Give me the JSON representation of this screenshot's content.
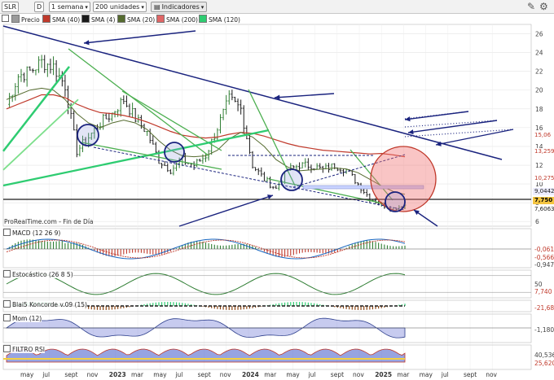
{
  "toolbar": {
    "symbol": "SLR",
    "d_label": "D",
    "period": "1 semana",
    "units": "200 unidades",
    "indicators": "Indicadores"
  },
  "legend": [
    {
      "label": "Precio",
      "color": "#9a9a9a",
      "name": "legend-precio"
    },
    {
      "label": "SMA (40)",
      "color": "#c0392b",
      "name": "legend-sma-40"
    },
    {
      "label": "SMA (4)",
      "color": "#1a1a1a",
      "name": "legend-sma-4"
    },
    {
      "label": "SMA (20)",
      "color": "#556b2f",
      "name": "legend-sma-20"
    },
    {
      "label": "SMA (200)",
      "color": "#e06666",
      "name": "legend-sma-200"
    },
    {
      "label": "SMA (120)",
      "color": "#2ecc71",
      "name": "legend-sma-120"
    }
  ],
  "source": "ProRealTime.com - Fin de Día",
  "price_tags": [
    {
      "value": "15,06",
      "color": "#c0392b",
      "bg": "#ffffff"
    },
    {
      "value": "13,259",
      "color": "#c0392b",
      "bg": "#ffffff"
    },
    {
      "value": "10,275",
      "color": "#c0392b",
      "bg": "#ffffff"
    },
    {
      "value": "9,0442",
      "color": "#1a1a1a",
      "bg": "#eeeeff"
    },
    {
      "value": "7,750",
      "color": "#000000",
      "bg": "#f4c542"
    },
    {
      "value": "7,6063",
      "color": "#1a1a1a",
      "bg": "#ffffff"
    }
  ],
  "panels": {
    "macd": {
      "title": "MACD (12 26 9)",
      "values": [
        "-0,061",
        "-0,566",
        "-0,947"
      ]
    },
    "stoch": {
      "title": "Estocástico (26 8 5)",
      "values": [
        "50",
        "7,740"
      ]
    },
    "koncorde": {
      "title": "Blai5 Koncorde v.09 (15)",
      "values": [
        "-21,68"
      ]
    },
    "mom": {
      "title": "Mom (12)",
      "values": [
        "-1,180"
      ]
    },
    "filtro": {
      "title": "FILTRO RSI",
      "values": [
        "40,536",
        "25,620"
      ]
    }
  },
  "colors": {
    "bull": "#2e7d32",
    "bear": "#1a1a1a",
    "trend": "#1a237e",
    "sma40": "#c0392b",
    "sma20": "#556b2f",
    "sma120": "#2ecc71",
    "sma200": "#e06666"
  },
  "chart_data": {
    "type": "line",
    "title": "",
    "xlabel": "",
    "ylabel": "",
    "ylim": [
      5.5,
      27
    ],
    "y_ticks": [
      6,
      8,
      10,
      12,
      14,
      16,
      18,
      20,
      22,
      24,
      26
    ],
    "x_ticks": [
      "may",
      "jul",
      "sept",
      "nov",
      "2023",
      "mar",
      "may",
      "jul",
      "sept",
      "nov",
      "2024",
      "mar",
      "may",
      "jul",
      "sept",
      "nov",
      "2025",
      "mar",
      "may",
      "jul",
      "sept",
      "nov"
    ],
    "x": [
      "2022-04",
      "2022-05",
      "2022-06",
      "2022-07",
      "2022-08",
      "2022-09",
      "2022-10",
      "2022-11",
      "2022-12",
      "2023-01",
      "2023-02",
      "2023-03",
      "2023-04",
      "2023-05",
      "2023-06",
      "2023-07",
      "2023-08",
      "2023-09",
      "2023-10",
      "2023-11",
      "2023-12",
      "2024-01",
      "2024-02",
      "2024-03",
      "2024-04",
      "2024-05",
      "2024-06",
      "2024-07",
      "2024-08",
      "2024-09",
      "2024-10",
      "2024-11",
      "2024-12",
      "2025-01",
      "2025-02"
    ],
    "series": [
      {
        "name": "Precio",
        "values": [
          18.5,
          21.5,
          22,
          23,
          22.5,
          20.5,
          13.5,
          15,
          16.5,
          17.5,
          19,
          17,
          15.5,
          12.5,
          11.5,
          12.5,
          12,
          13,
          16,
          19,
          18,
          12,
          10.5,
          9.5,
          11.5,
          12,
          12,
          11.5,
          12,
          11.5,
          10,
          8.5,
          7.8,
          7.4,
          7.75
        ]
      },
      {
        "name": "SMA (20)",
        "values": [
          19,
          19.5,
          20,
          20.2,
          20,
          19,
          17.5,
          16.5,
          16,
          16.5,
          16.8,
          16.5,
          15.8,
          14.6,
          13.6,
          13,
          12.9,
          13,
          13.6,
          14.8,
          15.5,
          15,
          14,
          12.6,
          11.8,
          11.4,
          11.5,
          11.6,
          11.7,
          11.6,
          11.2,
          10.5,
          9.8,
          9.2,
          8.9
        ]
      },
      {
        "name": "SMA (40)",
        "values": [
          18,
          18.5,
          19,
          19.5,
          19.5,
          19.2,
          18.5,
          18,
          17.6,
          17.5,
          17.3,
          17,
          16.6,
          16.1,
          15.6,
          15.2,
          15,
          14.9,
          15,
          15.3,
          15.5,
          15.4,
          15.1,
          14.7,
          14.3,
          14,
          13.8,
          13.6,
          13.5,
          13.4,
          13.3,
          13.2,
          13.25,
          13.1,
          12.9
        ]
      }
    ]
  }
}
